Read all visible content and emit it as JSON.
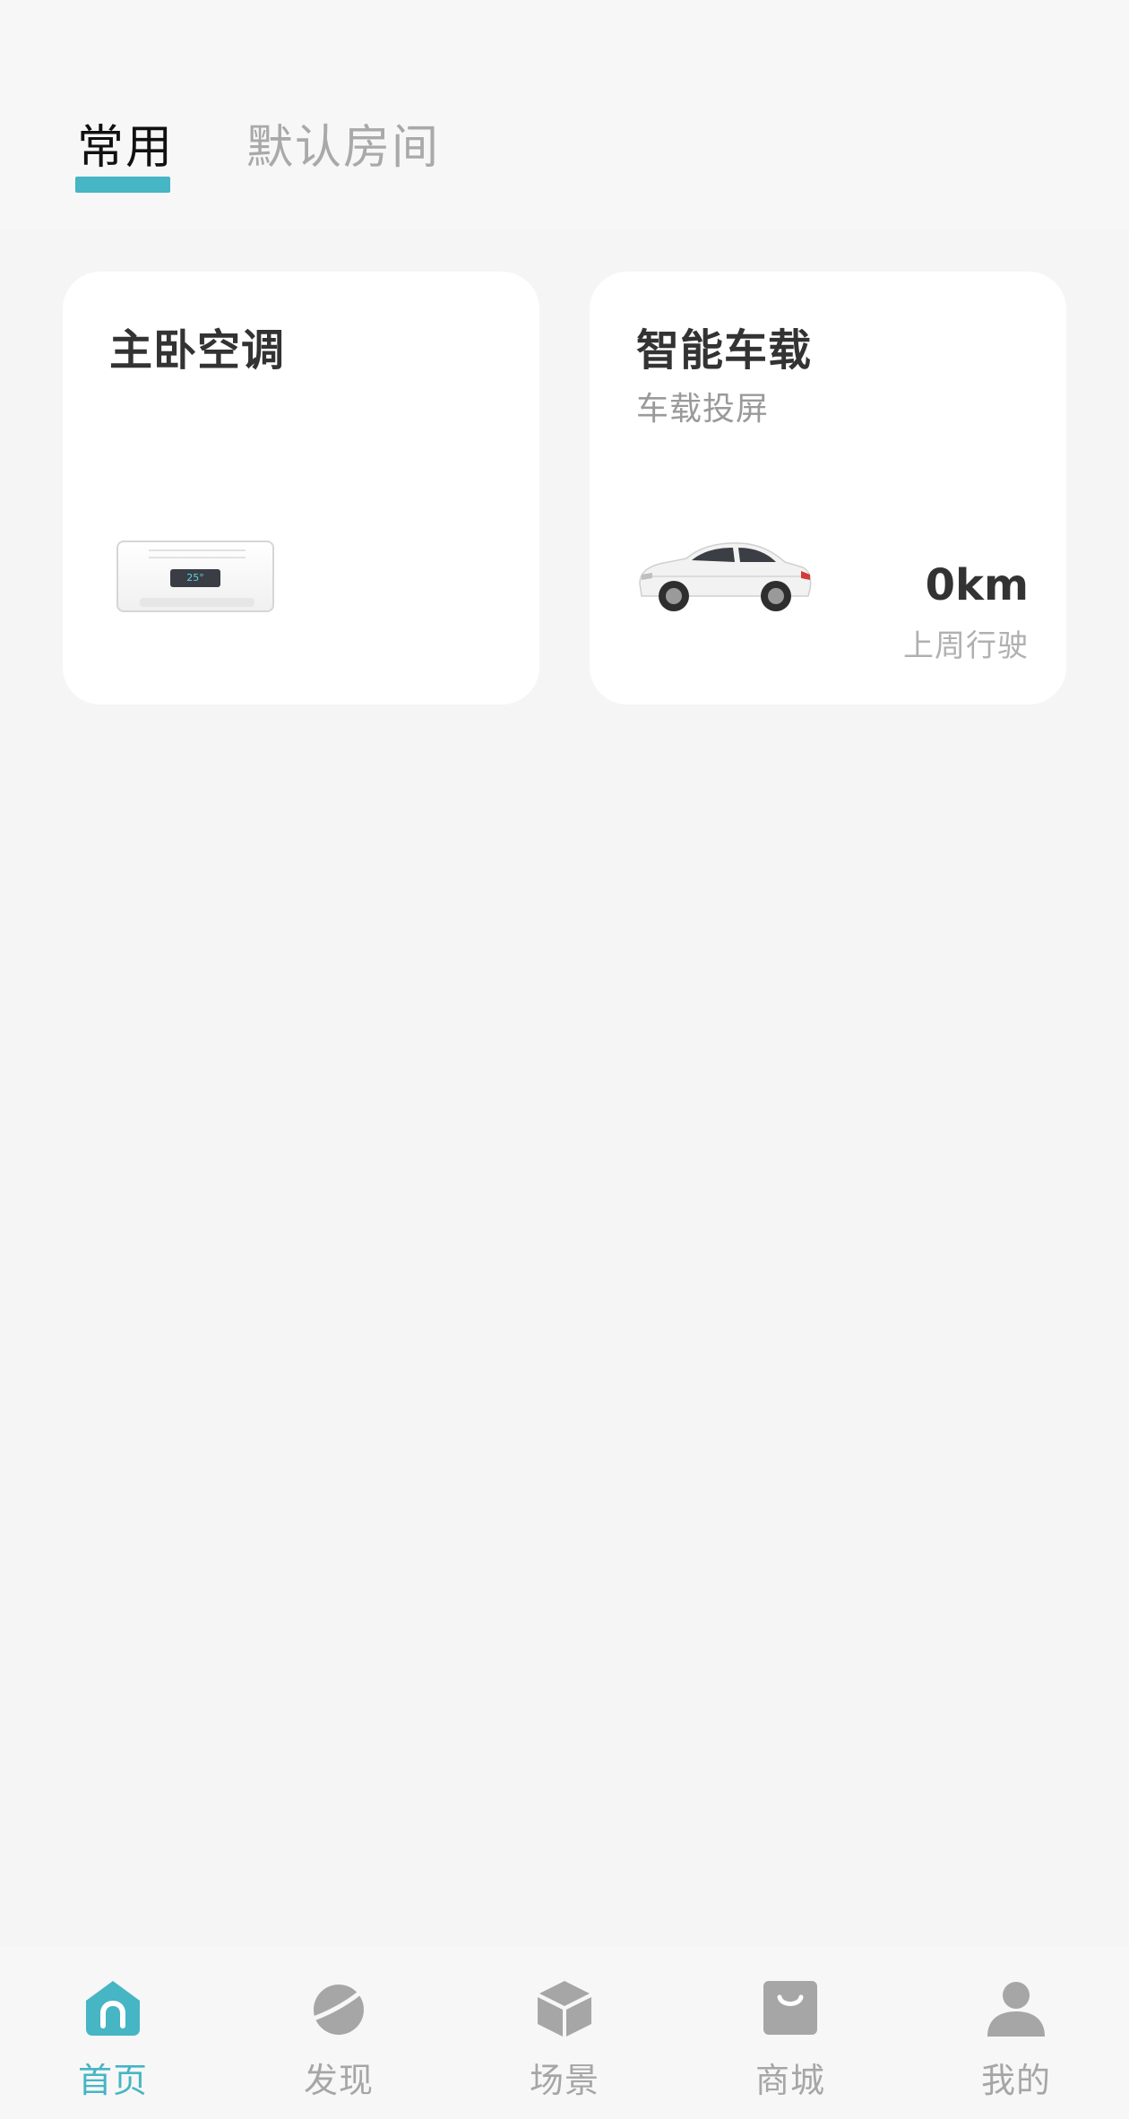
{
  "colors": {
    "accent": "#46b5c4",
    "inactive": "#a6a6a6",
    "title": "#333333",
    "background": "#f5f5f5",
    "card": "#ffffff"
  },
  "tabs": [
    {
      "label": "常用",
      "active": true
    },
    {
      "label": "默认房间",
      "active": false
    }
  ],
  "cards": {
    "ac": {
      "title": "主卧空调",
      "display_temp": "25°",
      "icon": "air-conditioner-image"
    },
    "car": {
      "title": "智能车载",
      "subtitle": "车载投屏",
      "distance": "0km",
      "distance_label": "上周行驶",
      "icon": "car-image"
    }
  },
  "bottom_nav": [
    {
      "label": "首页",
      "icon": "home-icon",
      "active": true
    },
    {
      "label": "发现",
      "icon": "planet-icon",
      "active": false
    },
    {
      "label": "场景",
      "icon": "cube-icon",
      "active": false
    },
    {
      "label": "商城",
      "icon": "shopping-bag-icon",
      "active": false
    },
    {
      "label": "我的",
      "icon": "person-icon",
      "active": false
    }
  ]
}
